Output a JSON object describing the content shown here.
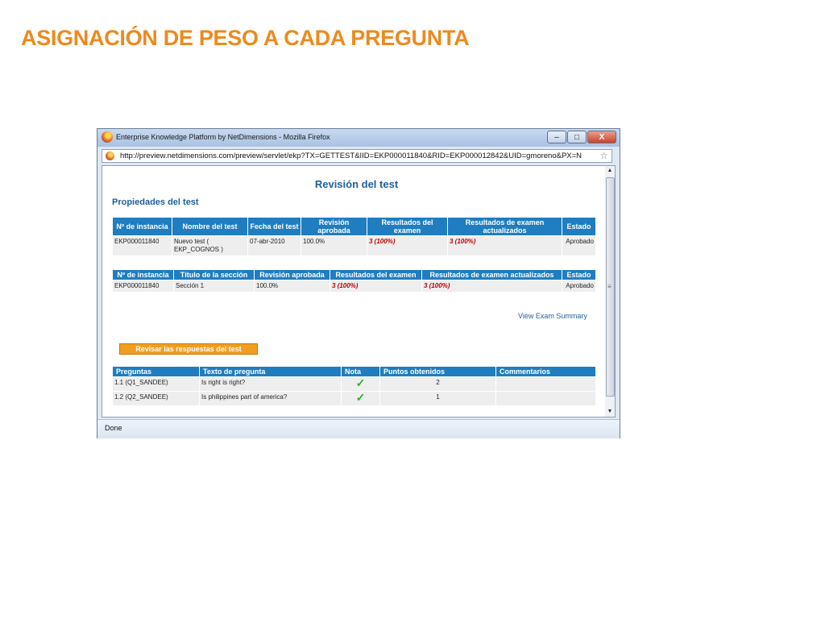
{
  "slide": {
    "title": "ASIGNACIÓN DE PESO A CADA PREGUNTA"
  },
  "window": {
    "title": "Enterprise Knowledge Platform by NetDimensions - Mozilla Firefox",
    "buttons": {
      "minimize": "–",
      "maximize": "□",
      "close": "X"
    }
  },
  "urlbar": {
    "url": "http://preview.netdimensions.com/preview/servlet/ekp?TX=GETTEST&IID=EKP000011840&RID=EKP000012842&UID=gmoreno&PX=N"
  },
  "page": {
    "heading": "Revisión del test",
    "section_heading": "Propiedades del test",
    "exam_summary_link": "View Exam Summary",
    "review_button": "Revisar las respuestas del test"
  },
  "test_table": {
    "headers": [
      "Nº de instancia",
      "Nombre del test",
      "Fecha del test",
      "Revisión aprobada",
      "Resultados del examen",
      "Resultados de examen actualizados",
      "Estado"
    ],
    "row": [
      "EKP000011840",
      "Nuevo test ( EKP_COGNOS )",
      "07-abr-2010",
      "100.0%",
      "3 (100%)",
      "3 (100%)",
      "Aprobado"
    ]
  },
  "section_table": {
    "headers": [
      "Nº de instancia",
      "Título de la sección",
      "Revisión aprobada",
      "Resultados del examen",
      "Resultados de examen actualizados",
      "Estado"
    ],
    "row": [
      "EKP000011840",
      "Sección 1",
      "100.0%",
      "3 (100%)",
      "3 (100%)",
      "Aprobado"
    ]
  },
  "questions_table": {
    "headers": [
      "Preguntas",
      "Texto de pregunta",
      "Nota",
      "Puntos obtenidos",
      "Commentarios"
    ],
    "rows": [
      {
        "question": "1.1 (Q1_SANDEE)",
        "text": "Is right is right?",
        "grade_icon": "check-icon",
        "points": "2",
        "comment": ""
      },
      {
        "question": "1.2 (Q2_SANDEE)",
        "text": "Is philippines part of america?",
        "grade_icon": "check-icon",
        "points": "1",
        "comment": ""
      }
    ]
  },
  "check_glyph": "✓",
  "status": {
    "text": "Done"
  },
  "colors": {
    "title": "#ec8a1f",
    "header_blue": "#1f7dc0",
    "button_orange": "#f29d1f",
    "result_red": "#c00000",
    "check_green": "#2eae2e"
  }
}
